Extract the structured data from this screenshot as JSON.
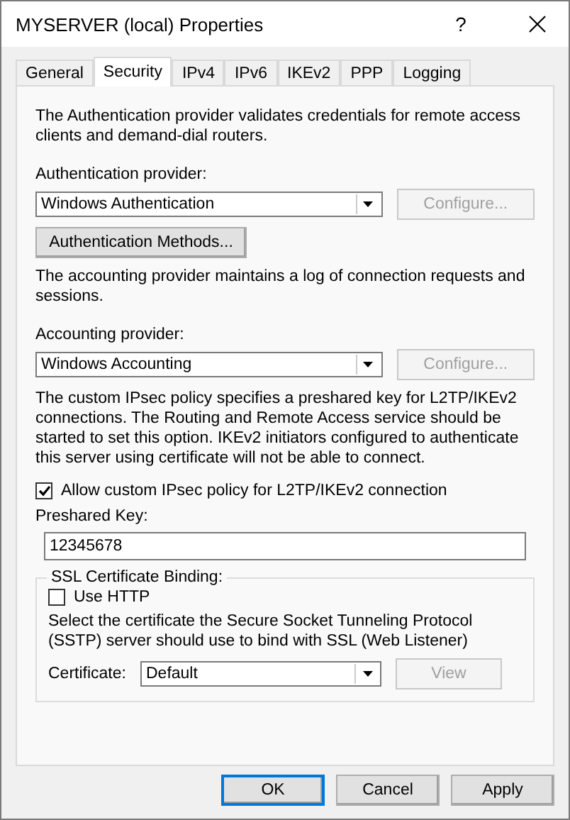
{
  "window": {
    "title": "MYSERVER (local) Properties",
    "help": "?"
  },
  "tabs": [
    {
      "label": "General",
      "selected": false
    },
    {
      "label": "Security",
      "selected": true
    },
    {
      "label": "IPv4",
      "selected": false
    },
    {
      "label": "IPv6",
      "selected": false
    },
    {
      "label": "IKEv2",
      "selected": false
    },
    {
      "label": "PPP",
      "selected": false
    },
    {
      "label": "Logging",
      "selected": false
    }
  ],
  "authentication": {
    "description": "The Authentication provider validates credentials for remote access clients and demand-dial routers.",
    "provider_label": "Authentication provider:",
    "provider": "Windows Authentication",
    "configure": {
      "label": "Configure...",
      "disabled": true
    },
    "methods_button": "Authentication Methods..."
  },
  "accounting": {
    "description": "The accounting provider maintains a log of connection requests and sessions.",
    "provider_label": "Accounting provider:",
    "provider": "Windows Accounting",
    "configure": {
      "label": "Configure...",
      "disabled": true
    }
  },
  "ipsec": {
    "description": "The custom IPsec policy specifies a preshared key for L2TP/IKEv2 connections. The Routing and Remote Access service should be started to set this option. IKEv2 initiators configured to authenticate this server using certificate will not be able to connect.",
    "allow": {
      "label": "Allow custom IPsec policy for L2TP/IKEv2 connection",
      "checked": true
    },
    "key_label": "Preshared Key:",
    "key": "12345678"
  },
  "ssl": {
    "legend": "SSL Certificate Binding:",
    "use_http": {
      "label": "Use HTTP",
      "checked": false
    },
    "description": "Select the certificate the Secure Socket Tunneling Protocol (SSTP) server should use to bind with SSL (Web Listener)",
    "certificate_label": "Certificate:",
    "certificate": "Default",
    "view": {
      "label": "View",
      "disabled": true
    }
  },
  "buttons": [
    {
      "label": "OK",
      "default": true
    },
    {
      "label": "Cancel",
      "default": false
    },
    {
      "label": "Apply",
      "default": false
    }
  ]
}
